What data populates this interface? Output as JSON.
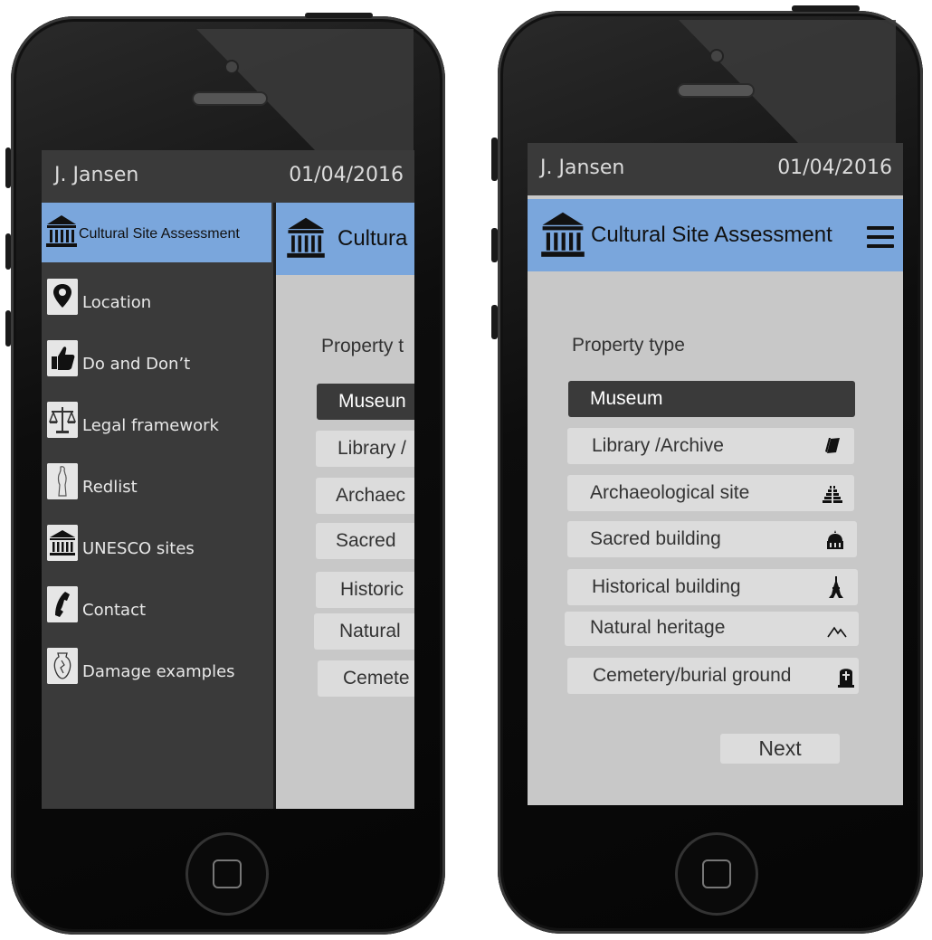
{
  "left_phone": {
    "status": {
      "user": "J. Jansen",
      "date": "01/04/2016"
    },
    "drawer": {
      "title": "Cultural Site Assessment",
      "items": [
        {
          "label": "Location",
          "icon": "location-pin-icon"
        },
        {
          "label": "Do and Don’t",
          "icon": "thumbs-up-icon"
        },
        {
          "label": "Legal framework",
          "icon": "scales-icon"
        },
        {
          "label": "Redlist",
          "icon": "statue-icon"
        },
        {
          "label": "UNESCO sites",
          "icon": "temple-icon"
        },
        {
          "label": "Contact",
          "icon": "phone-icon"
        },
        {
          "label": "Damage examples",
          "icon": "broken-vase-icon"
        }
      ]
    },
    "peek": {
      "title": "Cultura",
      "property_label": "Property t",
      "options": [
        "Museun",
        "Library /",
        "Archaec",
        "Sacred",
        "Historic",
        "Natural",
        "Cemete"
      ]
    }
  },
  "right_phone": {
    "status": {
      "user": "J. Jansen",
      "date": "01/04/2016"
    },
    "header": {
      "title": "Cultural Site Assessment",
      "menu_icon": "hamburger-menu-icon"
    },
    "property_label": "Property type",
    "options": [
      {
        "label": "Museum",
        "selected": true,
        "icon": ""
      },
      {
        "label": "Library /Archive",
        "selected": false,
        "icon": "book-icon"
      },
      {
        "label": "Archaeological site",
        "selected": false,
        "icon": "pyramid-icon"
      },
      {
        "label": "Sacred building",
        "selected": false,
        "icon": "mosque-icon"
      },
      {
        "label": "Historical building",
        "selected": false,
        "icon": "eiffel-tower-icon"
      },
      {
        "label": "Natural heritage",
        "selected": false,
        "icon": "mountains-icon"
      },
      {
        "label": "Cemetery/burial ground",
        "selected": false,
        "icon": "gravestone-icon"
      }
    ],
    "next_label": "Next"
  },
  "colors": {
    "header_blue": "#7aa6dc",
    "dark": "#3a3a3a",
    "screen_gray": "#c8c8c8",
    "option_gray": "#dcdcdc"
  }
}
